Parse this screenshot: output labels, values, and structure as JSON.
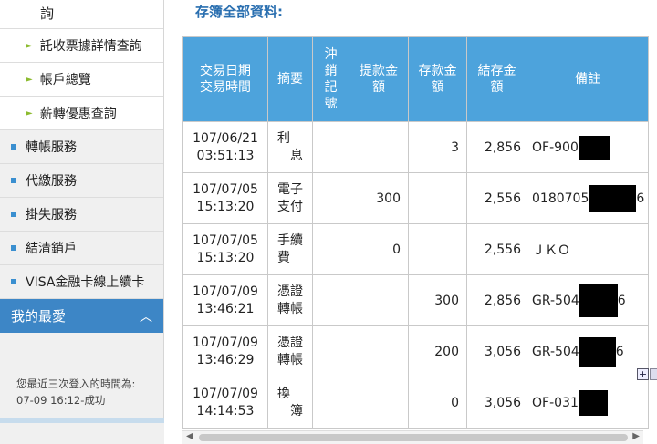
{
  "sidebar": {
    "top_partial_label": "詢",
    "sub_items": [
      {
        "label": "託收票據詳情查詢"
      },
      {
        "label": "帳戶總覽"
      },
      {
        "label": "薪轉優惠查詢"
      }
    ],
    "items": [
      {
        "label": "轉帳服務"
      },
      {
        "label": "代繳服務"
      },
      {
        "label": "掛失服務"
      },
      {
        "label": "結清銷戶"
      },
      {
        "label": "VISA金融卡線上續卡"
      }
    ],
    "favorites": {
      "label": "我的最愛",
      "icon": "chevron-up-icon"
    },
    "login_info": {
      "label": "您最近三次登入的時間為:",
      "entry": "07-09 16:12-成功"
    }
  },
  "main": {
    "title": "存簿全部資料:",
    "headers": {
      "date_line1": "交易日期",
      "date_line2": "交易時間",
      "memo": "摘要",
      "reversal": "沖\n銷\n記\n號",
      "withdrawal": "提款金\n額",
      "deposit": "存款金\n額",
      "balance": "結存金\n額",
      "note": "備註"
    },
    "rows": [
      {
        "date": "107/06/21",
        "time": "03:51:13",
        "memo_a": "利",
        "memo_b": "息",
        "reversal": "",
        "withdrawal": "",
        "deposit": "3",
        "balance": "2,856",
        "note": "OF-900",
        "note_tail": ""
      },
      {
        "date": "107/07/05",
        "time": "15:13:20",
        "memo_a": "電子",
        "memo_b": "支付",
        "reversal": "",
        "withdrawal": "300",
        "deposit": "",
        "balance": "2,556",
        "note": "0180705",
        "note_tail": "6"
      },
      {
        "date": "107/07/05",
        "time": "15:13:20",
        "memo_a": "手續",
        "memo_b": "費",
        "reversal": "",
        "withdrawal": "0",
        "deposit": "",
        "balance": "2,556",
        "note": "ＪＫＯ",
        "note_tail": ""
      },
      {
        "date": "107/07/09",
        "time": "13:46:21",
        "memo_a": "憑證",
        "memo_b": "轉帳",
        "reversal": "",
        "withdrawal": "",
        "deposit": "300",
        "balance": "2,856",
        "note": "GR-504",
        "note_tail": "6"
      },
      {
        "date": "107/07/09",
        "time": "13:46:29",
        "memo_a": "憑證",
        "memo_b": "轉帳",
        "reversal": "",
        "withdrawal": "",
        "deposit": "200",
        "balance": "3,056",
        "note": "GR-504",
        "note_tail": "6"
      },
      {
        "date": "107/07/09",
        "time": "14:14:53",
        "memo_a": "換",
        "memo_b": "簿",
        "reversal": "",
        "withdrawal": "",
        "deposit": "0",
        "balance": "3,056",
        "note": "OF-031",
        "note_tail": ""
      }
    ]
  },
  "colors": {
    "header_bg": "#4da3dc",
    "title": "#2a6fb0",
    "favorites_bg": "#3d86c6",
    "bullet": "#3a8fd0",
    "sub_arrow": "#8cbb2f"
  }
}
